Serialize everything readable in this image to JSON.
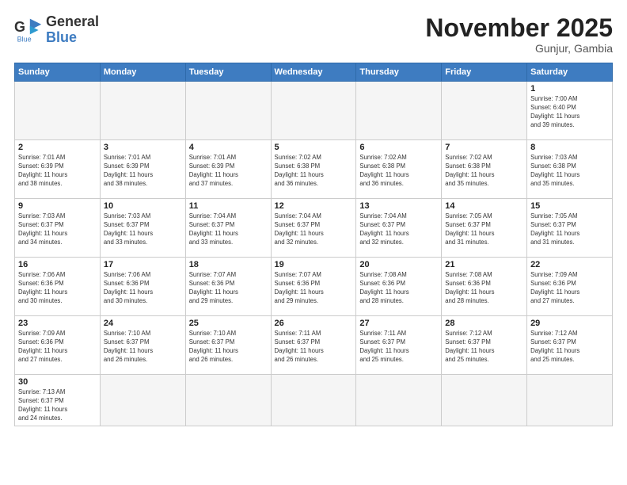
{
  "logo": {
    "line1": "General",
    "line2": "Blue"
  },
  "title": "November 2025",
  "subtitle": "Gunjur, Gambia",
  "weekdays": [
    "Sunday",
    "Monday",
    "Tuesday",
    "Wednesday",
    "Thursday",
    "Friday",
    "Saturday"
  ],
  "weeks": [
    [
      {
        "day": "",
        "info": ""
      },
      {
        "day": "",
        "info": ""
      },
      {
        "day": "",
        "info": ""
      },
      {
        "day": "",
        "info": ""
      },
      {
        "day": "",
        "info": ""
      },
      {
        "day": "",
        "info": ""
      },
      {
        "day": "1",
        "info": "Sunrise: 7:00 AM\nSunset: 6:40 PM\nDaylight: 11 hours\nand 39 minutes."
      }
    ],
    [
      {
        "day": "2",
        "info": "Sunrise: 7:01 AM\nSunset: 6:39 PM\nDaylight: 11 hours\nand 38 minutes."
      },
      {
        "day": "3",
        "info": "Sunrise: 7:01 AM\nSunset: 6:39 PM\nDaylight: 11 hours\nand 38 minutes."
      },
      {
        "day": "4",
        "info": "Sunrise: 7:01 AM\nSunset: 6:39 PM\nDaylight: 11 hours\nand 37 minutes."
      },
      {
        "day": "5",
        "info": "Sunrise: 7:02 AM\nSunset: 6:38 PM\nDaylight: 11 hours\nand 36 minutes."
      },
      {
        "day": "6",
        "info": "Sunrise: 7:02 AM\nSunset: 6:38 PM\nDaylight: 11 hours\nand 36 minutes."
      },
      {
        "day": "7",
        "info": "Sunrise: 7:02 AM\nSunset: 6:38 PM\nDaylight: 11 hours\nand 35 minutes."
      },
      {
        "day": "8",
        "info": "Sunrise: 7:03 AM\nSunset: 6:38 PM\nDaylight: 11 hours\nand 35 minutes."
      }
    ],
    [
      {
        "day": "9",
        "info": "Sunrise: 7:03 AM\nSunset: 6:37 PM\nDaylight: 11 hours\nand 34 minutes."
      },
      {
        "day": "10",
        "info": "Sunrise: 7:03 AM\nSunset: 6:37 PM\nDaylight: 11 hours\nand 33 minutes."
      },
      {
        "day": "11",
        "info": "Sunrise: 7:04 AM\nSunset: 6:37 PM\nDaylight: 11 hours\nand 33 minutes."
      },
      {
        "day": "12",
        "info": "Sunrise: 7:04 AM\nSunset: 6:37 PM\nDaylight: 11 hours\nand 32 minutes."
      },
      {
        "day": "13",
        "info": "Sunrise: 7:04 AM\nSunset: 6:37 PM\nDaylight: 11 hours\nand 32 minutes."
      },
      {
        "day": "14",
        "info": "Sunrise: 7:05 AM\nSunset: 6:37 PM\nDaylight: 11 hours\nand 31 minutes."
      },
      {
        "day": "15",
        "info": "Sunrise: 7:05 AM\nSunset: 6:37 PM\nDaylight: 11 hours\nand 31 minutes."
      }
    ],
    [
      {
        "day": "16",
        "info": "Sunrise: 7:06 AM\nSunset: 6:36 PM\nDaylight: 11 hours\nand 30 minutes."
      },
      {
        "day": "17",
        "info": "Sunrise: 7:06 AM\nSunset: 6:36 PM\nDaylight: 11 hours\nand 30 minutes."
      },
      {
        "day": "18",
        "info": "Sunrise: 7:07 AM\nSunset: 6:36 PM\nDaylight: 11 hours\nand 29 minutes."
      },
      {
        "day": "19",
        "info": "Sunrise: 7:07 AM\nSunset: 6:36 PM\nDaylight: 11 hours\nand 29 minutes."
      },
      {
        "day": "20",
        "info": "Sunrise: 7:08 AM\nSunset: 6:36 PM\nDaylight: 11 hours\nand 28 minutes."
      },
      {
        "day": "21",
        "info": "Sunrise: 7:08 AM\nSunset: 6:36 PM\nDaylight: 11 hours\nand 28 minutes."
      },
      {
        "day": "22",
        "info": "Sunrise: 7:09 AM\nSunset: 6:36 PM\nDaylight: 11 hours\nand 27 minutes."
      }
    ],
    [
      {
        "day": "23",
        "info": "Sunrise: 7:09 AM\nSunset: 6:36 PM\nDaylight: 11 hours\nand 27 minutes."
      },
      {
        "day": "24",
        "info": "Sunrise: 7:10 AM\nSunset: 6:37 PM\nDaylight: 11 hours\nand 26 minutes."
      },
      {
        "day": "25",
        "info": "Sunrise: 7:10 AM\nSunset: 6:37 PM\nDaylight: 11 hours\nand 26 minutes."
      },
      {
        "day": "26",
        "info": "Sunrise: 7:11 AM\nSunset: 6:37 PM\nDaylight: 11 hours\nand 26 minutes."
      },
      {
        "day": "27",
        "info": "Sunrise: 7:11 AM\nSunset: 6:37 PM\nDaylight: 11 hours\nand 25 minutes."
      },
      {
        "day": "28",
        "info": "Sunrise: 7:12 AM\nSunset: 6:37 PM\nDaylight: 11 hours\nand 25 minutes."
      },
      {
        "day": "29",
        "info": "Sunrise: 7:12 AM\nSunset: 6:37 PM\nDaylight: 11 hours\nand 25 minutes."
      }
    ],
    [
      {
        "day": "30",
        "info": "Sunrise: 7:13 AM\nSunset: 6:37 PM\nDaylight: 11 hours\nand 24 minutes."
      },
      {
        "day": "",
        "info": ""
      },
      {
        "day": "",
        "info": ""
      },
      {
        "day": "",
        "info": ""
      },
      {
        "day": "",
        "info": ""
      },
      {
        "day": "",
        "info": ""
      },
      {
        "day": "",
        "info": ""
      }
    ]
  ]
}
